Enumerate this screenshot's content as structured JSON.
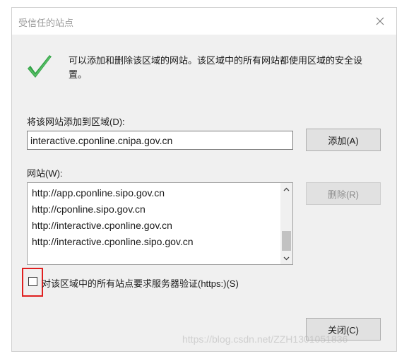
{
  "dialog": {
    "title": "受信任的站点",
    "close_glyph": "✕",
    "info_text": "可以添加和删除该区域的网站。该区域中的所有网站都使用区域的安全设置。",
    "add_label": "将该网站添加到区域(D):",
    "url_value": "interactive.cponline.cnipa.gov.cn",
    "add_button": "添加(A)",
    "sites_label": "网站(W):",
    "sites": [
      "http://app.cponline.sipo.gov.cn",
      "http://cponline.sipo.gov.cn",
      "http://interactive.cponline.gov.cn",
      "http://interactive.cponline.sipo.gov.cn"
    ],
    "remove_button": "删除(R)",
    "https_label": "对该区域中的所有站点要求服务器验证(https:)(S)",
    "https_checked": false,
    "close_button": "关闭(C)"
  },
  "watermark": "https://blog.csdn.net/ZZH1301051836",
  "colors": {
    "dialog_bg": "#f0f0f0",
    "check_icon": "#2ea043",
    "highlight_box": "#e02020"
  },
  "icons": {
    "info": "checkmark-icon",
    "close": "close-icon",
    "scroll_up": "chevron-up-icon",
    "scroll_down": "chevron-down-icon"
  }
}
